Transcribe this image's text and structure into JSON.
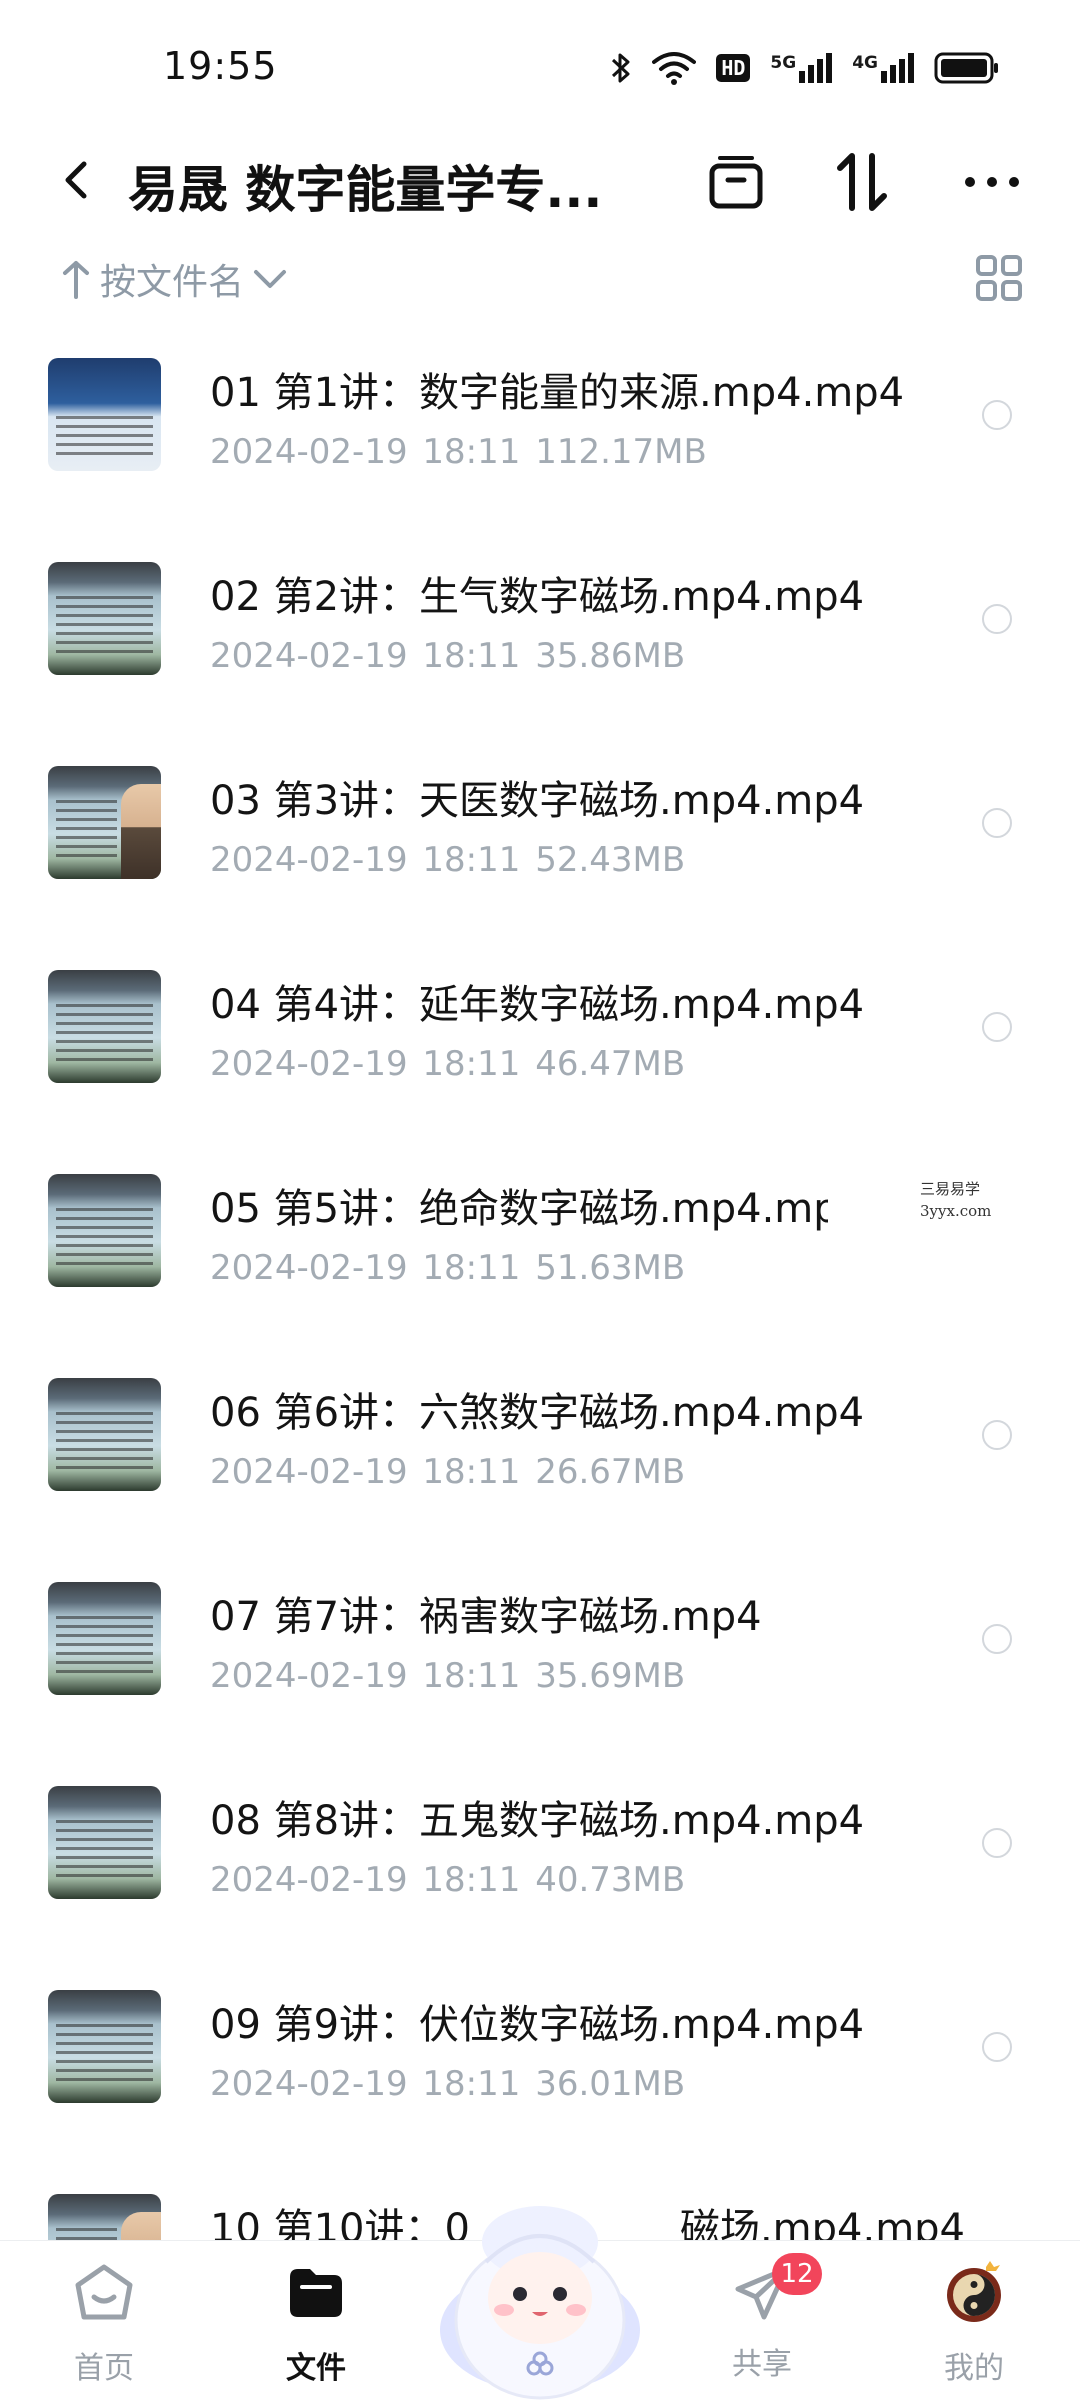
{
  "status_bar": {
    "time": "19:55",
    "icons": [
      "bluetooth-icon",
      "wifi-icon",
      "hd-icon",
      "signal-5g-icon",
      "signal-4g-icon",
      "battery-icon"
    ],
    "network_5g": "5G",
    "network_4g": "4G",
    "hd": "HD"
  },
  "header": {
    "title": "易晟 数字能量学专...",
    "icons": [
      "back-icon",
      "archive-icon",
      "sort-order-icon",
      "more-icon"
    ]
  },
  "sort": {
    "label": "按文件名",
    "icons": [
      "arrow-up-icon",
      "chevron-down-icon",
      "grid-view-icon"
    ]
  },
  "files": [
    {
      "name": "01 第1讲：数字能量的来源.mp4.mp4",
      "date": "2024-02-19",
      "time": "18:11",
      "size": "112.17MB"
    },
    {
      "name": "02 第2讲：生气数字磁场.mp4.mp4",
      "date": "2024-02-19",
      "time": "18:11",
      "size": "35.86MB"
    },
    {
      "name": "03 第3讲：天医数字磁场.mp4.mp4",
      "date": "2024-02-19",
      "time": "18:11",
      "size": "52.43MB"
    },
    {
      "name": "04 第4讲：延年数字磁场.mp4.mp4",
      "date": "2024-02-19",
      "time": "18:11",
      "size": "46.47MB"
    },
    {
      "name": "05 第5讲：绝命数字磁场.mp4.mp",
      "date": "2024-02-19",
      "time": "18:11",
      "size": "51.63MB"
    },
    {
      "name": "06 第6讲：六煞数字磁场.mp4.mp4",
      "date": "2024-02-19",
      "time": "18:11",
      "size": "26.67MB"
    },
    {
      "name": "07 第7讲：祸害数字磁场.mp4",
      "date": "2024-02-19",
      "time": "18:11",
      "size": "35.69MB"
    },
    {
      "name": "08 第8讲：五鬼数字磁场.mp4.mp4",
      "date": "2024-02-19",
      "time": "18:11",
      "size": "40.73MB"
    },
    {
      "name": "09 第9讲：伏位数字磁场.mp4.mp4",
      "date": "2024-02-19",
      "time": "18:11",
      "size": "36.01MB"
    },
    {
      "name": "10 第10讲：0",
      "name_tail": "磁场.mp4.mp4",
      "date": "",
      "time": "",
      "size": ""
    }
  ],
  "watermark": {
    "line1": "三易易学",
    "line2": "3yyx.com"
  },
  "bottom_nav": {
    "items": [
      {
        "label": "首页",
        "icon": "home-icon"
      },
      {
        "label": "文件",
        "icon": "folder-icon"
      },
      {
        "label": "共享",
        "icon": "share-plane-icon",
        "badge": "12"
      },
      {
        "label": "我的",
        "icon": "avatar-icon"
      }
    ],
    "center": "mascot-icon"
  },
  "colors": {
    "accent_badge": "#f2455b",
    "meta_text": "#a3abb3",
    "sort_text": "#8e9aa6"
  }
}
